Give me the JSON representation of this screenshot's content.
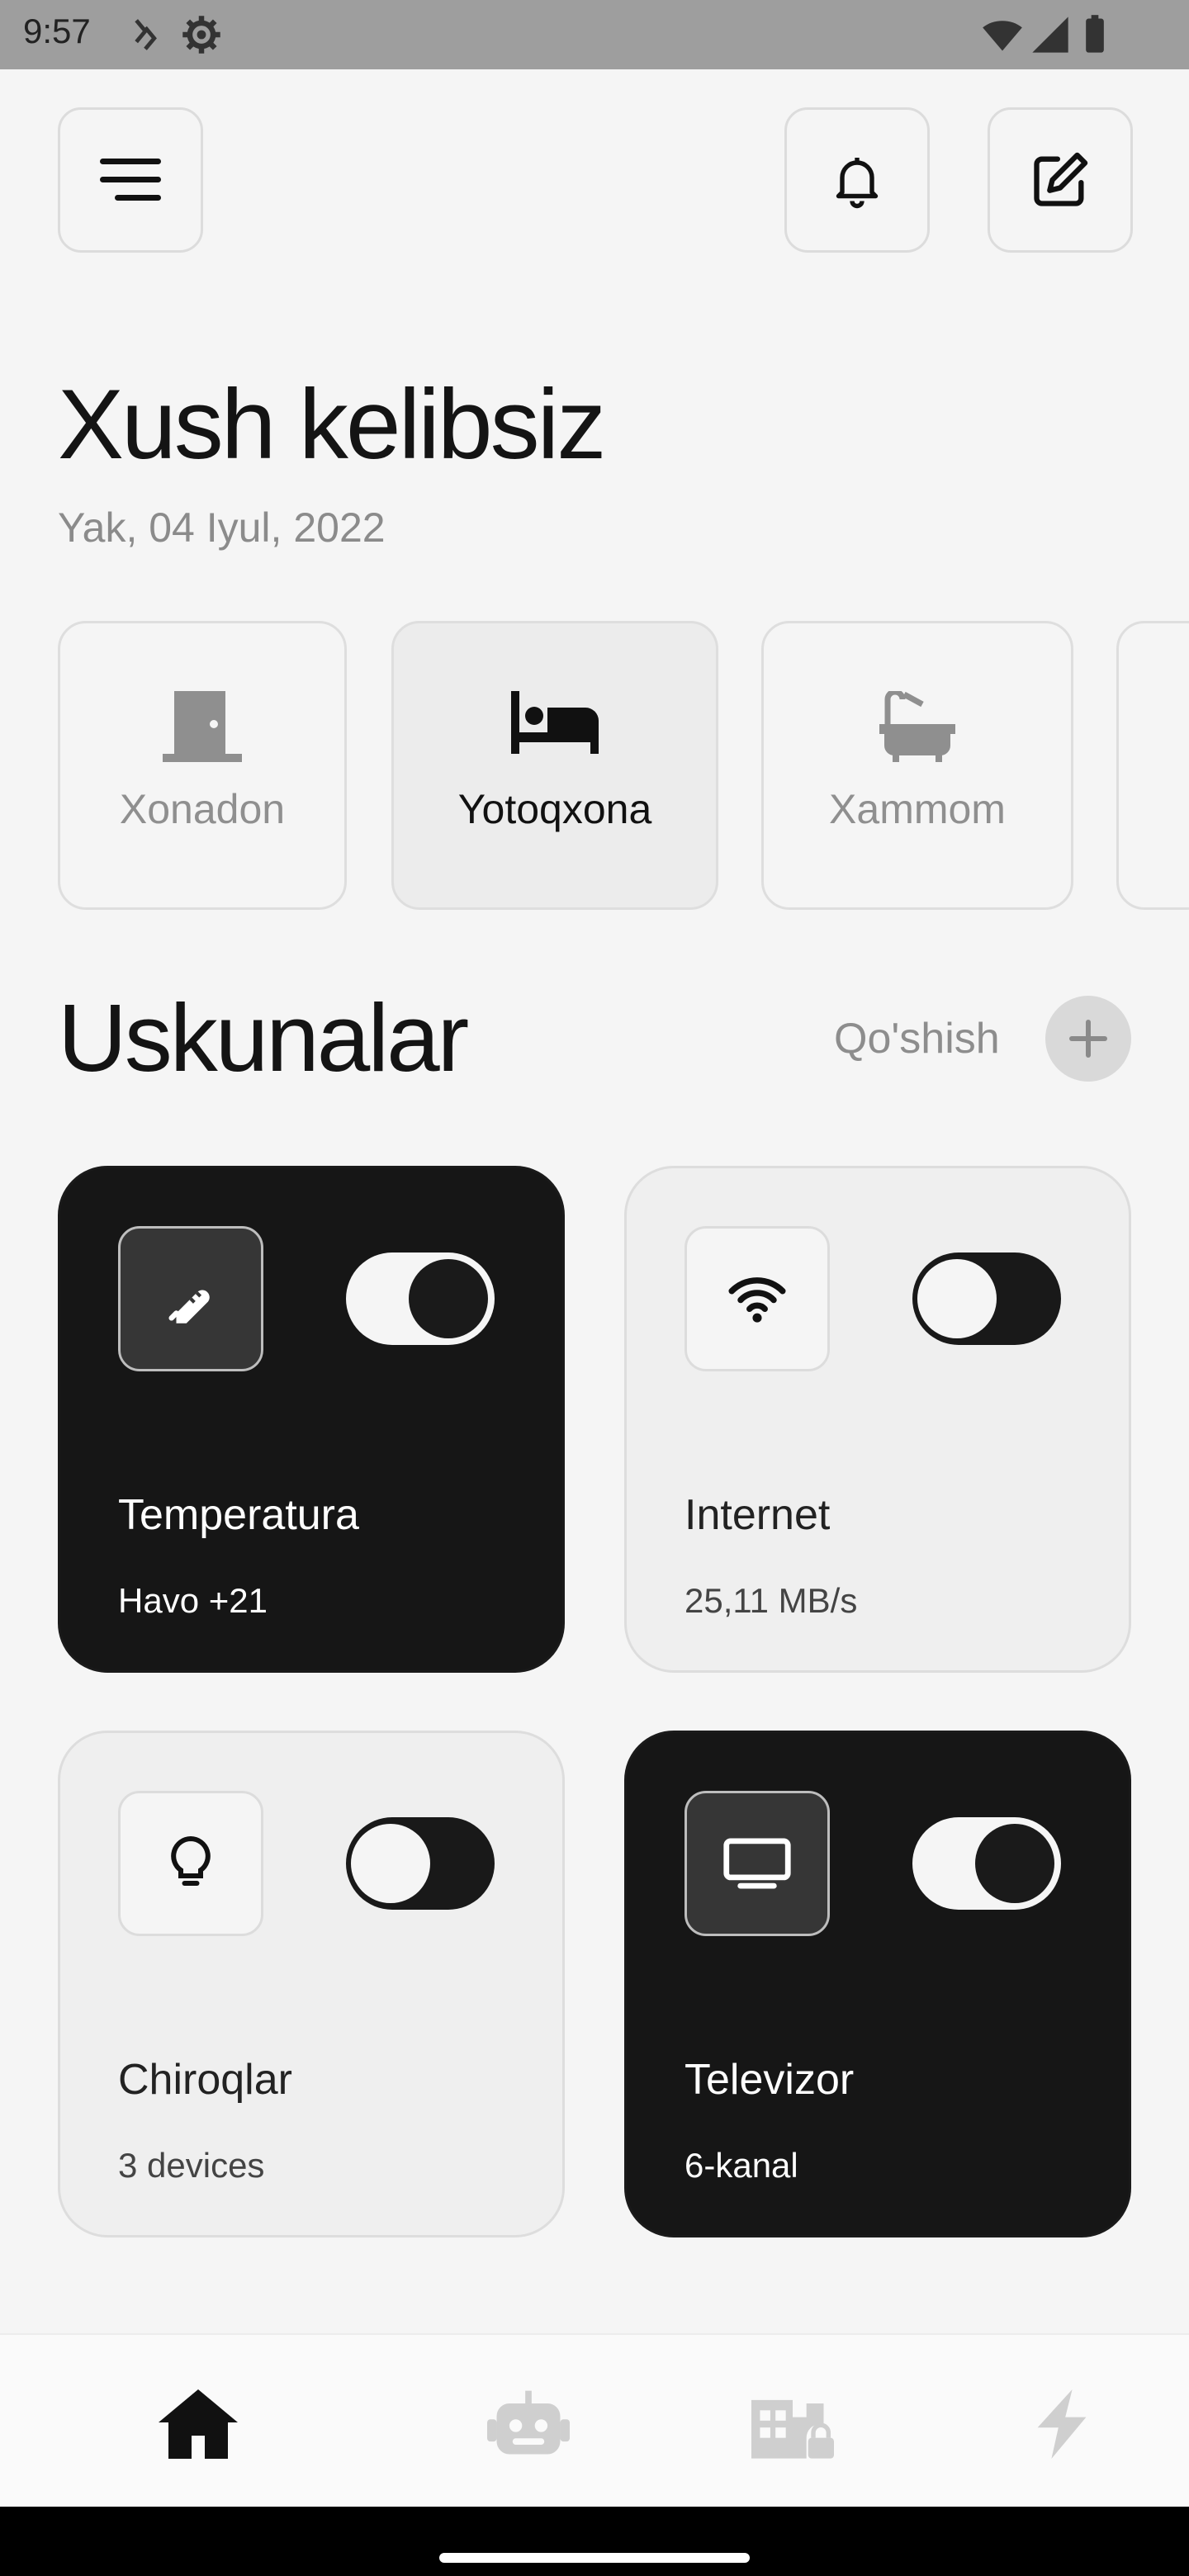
{
  "status_bar": {
    "time": "9:57",
    "icons": [
      "data-saver-icon",
      "settings-gear-icon",
      "wifi-icon",
      "signal-icon",
      "battery-icon"
    ]
  },
  "header": {
    "icons": [
      "menu-icon",
      "bell-icon",
      "edit-icon"
    ]
  },
  "greeting": {
    "title": "Xush kelibsiz",
    "date": "Yak, 04 Iyul, 2022"
  },
  "rooms": [
    {
      "label": "Xonadon",
      "icon": "door-icon",
      "active": false
    },
    {
      "label": "Yotoqxona",
      "icon": "bed-icon",
      "active": true
    },
    {
      "label": "Xammom",
      "icon": "bathtub-icon",
      "active": false
    }
  ],
  "devices_section": {
    "title": "Uskunalar",
    "add_label": "Qo'shish"
  },
  "devices": [
    {
      "name": "Temperatura",
      "value": "Havo +21",
      "icon": "thermometer-icon",
      "on": true
    },
    {
      "name": "Internet",
      "value": "25,11 MB/s",
      "icon": "wifi-icon",
      "on": false
    },
    {
      "name": "Chiroqlar",
      "value": "3 devices",
      "icon": "lightbulb-icon",
      "on": false
    },
    {
      "name": "Televizor",
      "value": "6-kanal",
      "icon": "monitor-icon",
      "on": true
    }
  ],
  "bottom_nav": {
    "items": [
      "home-icon",
      "robot-icon",
      "building-lock-icon",
      "bolt-icon"
    ],
    "active": "home-icon"
  },
  "colors": {
    "background": "#f5f5f5",
    "dark_card": "#161616",
    "light_card": "#efefef",
    "muted_text": "#8b8b8b"
  }
}
